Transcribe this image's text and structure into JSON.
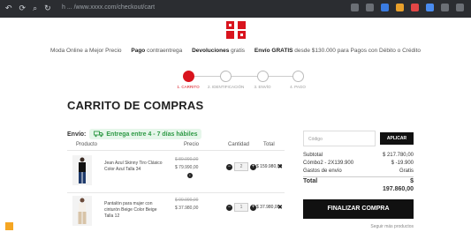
{
  "browser": {
    "url": "h ... /www.xxxx.com/checkout/cart"
  },
  "strip": {
    "t1": "Moda Online a Mejor Precio",
    "b2": "Pago",
    "t2": "contraentrega",
    "b3": "Devoluciones",
    "t3": "gratis",
    "b4": "Envío GRATIS",
    "t4": "desde $130.000 para Pagos con Débito o Crédito"
  },
  "steps": [
    {
      "label": "1. CARRITO",
      "active": true
    },
    {
      "label": "2. IDENTIFICACIÓN",
      "active": false
    },
    {
      "label": "3. ENVÍO",
      "active": false
    },
    {
      "label": "4. PAGO",
      "active": false
    }
  ],
  "page_title": "CARRITO DE COMPRAS",
  "envio": {
    "label": "Envío:",
    "badge": "Entrega entre 4 - 7 días hábiles"
  },
  "table": {
    "headers": {
      "product": "Producto",
      "price": "Precio",
      "qty": "Cantidad",
      "total": "Total"
    },
    "rows": [
      {
        "name": "Jean Azul Skinny Tiro Clásico Color Azul Talla 34",
        "old_price": "$ 89.990,00",
        "new_price": "$ 79.990,00",
        "qty": "2",
        "total": "$ 159.980,00"
      },
      {
        "name": "Pantalón para mujer con cinturón Beige Color Beige Talla 12",
        "old_price": "$ 99.990,00",
        "new_price": "$ 37.980,00",
        "qty": "1",
        "total": "$ 37.980,00"
      }
    ]
  },
  "summary": {
    "coupon_placeholder": "Código",
    "apply": "APLICAR",
    "subtotal_label": "Subtotal",
    "subtotal": "$ 217.780,00",
    "discount_label": "Cómbo2 - 2X139.900",
    "discount": "$ -19.900",
    "shipping_label": "Gastos de envío",
    "shipping": "Gratis",
    "total_label": "Total",
    "total_currency": "$",
    "total": "197.860,00",
    "checkout": "FINALIZAR COMPRA",
    "continue": "Seguir más productos"
  },
  "colors": {
    "accent": "#d9141e",
    "success": "#2f9a46"
  }
}
